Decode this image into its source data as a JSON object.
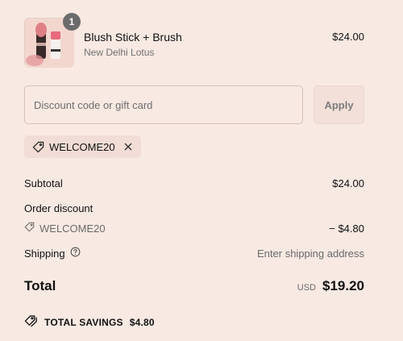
{
  "product": {
    "quantity": "1",
    "name": "Blush Stick + Brush",
    "subtitle": "New Delhi Lotus",
    "price": "$24.00"
  },
  "discount": {
    "placeholder": "Discount code or gift card",
    "value": "",
    "apply_label": "Apply",
    "applied_code": "WELCOME20"
  },
  "summary": {
    "subtotal_label": "Subtotal",
    "subtotal_value": "$24.00",
    "order_discount_label": "Order discount",
    "discount_code": "WELCOME20",
    "discount_value": "− $4.80",
    "shipping_label": "Shipping",
    "shipping_value": "Enter shipping address",
    "total_label": "Total",
    "currency": "USD",
    "total_value": "$19.20",
    "savings_label": "TOTAL SAVINGS",
    "savings_value": "$4.80"
  },
  "icons": {
    "tag": "tag-icon",
    "close": "close-icon",
    "help": "help-circle-icon",
    "savings": "double-tag-icon"
  }
}
